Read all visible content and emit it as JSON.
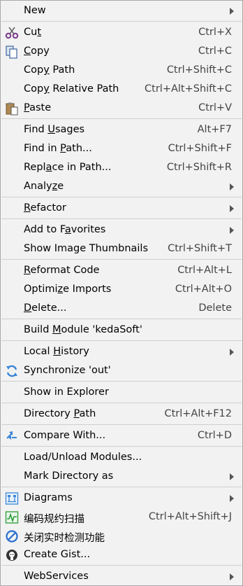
{
  "menu": {
    "new": {
      "pre": "New",
      "mn": "",
      "post": ""
    },
    "cut": {
      "pre": "Cu",
      "mn": "t",
      "post": "",
      "shortcut": "Ctrl+X",
      "icon": "scissors-icon"
    },
    "copy": {
      "pre": "",
      "mn": "C",
      "post": "opy",
      "shortcut": "Ctrl+C",
      "icon": "copy-icon"
    },
    "copy_path": {
      "pre": "Cop",
      "mn": "y",
      "post": " Path",
      "shortcut": "Ctrl+Shift+C"
    },
    "copy_relative_path": {
      "pre": "Cop",
      "mn": "y",
      "post": " Relative Path",
      "shortcut": "Ctrl+Alt+Shift+C"
    },
    "paste": {
      "pre": "",
      "mn": "P",
      "post": "aste",
      "shortcut": "Ctrl+V",
      "icon": "paste-icon"
    },
    "find_usages": {
      "pre": "Find ",
      "mn": "U",
      "post": "sages",
      "shortcut": "Alt+F7"
    },
    "find_in_path": {
      "pre": "Find in ",
      "mn": "P",
      "post": "ath...",
      "shortcut": "Ctrl+Shift+F"
    },
    "replace_in_path": {
      "pre": "Repl",
      "mn": "a",
      "post": "ce in Path...",
      "shortcut": "Ctrl+Shift+R"
    },
    "analyze": {
      "pre": "Analy",
      "mn": "z",
      "post": "e"
    },
    "refactor": {
      "pre": "",
      "mn": "R",
      "post": "efactor"
    },
    "add_to_favorites": {
      "pre": "Add to F",
      "mn": "a",
      "post": "vorites"
    },
    "show_image_thumbnails": {
      "pre": "Show Image Thumbnails",
      "mn": "",
      "post": "",
      "shortcut": "Ctrl+Shift+T"
    },
    "reformat_code": {
      "pre": "",
      "mn": "R",
      "post": "eformat Code",
      "shortcut": "Ctrl+Alt+L"
    },
    "optimize_imports": {
      "pre": "Optimi",
      "mn": "z",
      "post": "e Imports",
      "shortcut": "Ctrl+Alt+O"
    },
    "delete": {
      "pre": "",
      "mn": "D",
      "post": "elete...",
      "shortcut": "Delete"
    },
    "build_module": {
      "pre": "Build ",
      "mn": "M",
      "post": "odule 'kedaSoft'"
    },
    "local_history": {
      "pre": "Local ",
      "mn": "H",
      "post": "istory"
    },
    "synchronize": {
      "pre": "Synchronize 'out'",
      "mn": "",
      "post": "",
      "icon": "sync-icon"
    },
    "show_in_explorer": {
      "pre": "Show in Explorer",
      "mn": "",
      "post": ""
    },
    "directory_path": {
      "pre": "Directory ",
      "mn": "P",
      "post": "ath",
      "shortcut": "Ctrl+Alt+F12"
    },
    "compare_with": {
      "pre": "Compare With...",
      "mn": "",
      "post": "",
      "shortcut": "Ctrl+D",
      "icon": "compare-icon"
    },
    "load_unload_modules": {
      "pre": "Load/Unload Modules...",
      "mn": "",
      "post": ""
    },
    "mark_directory_as": {
      "pre": "Mark Directory as",
      "mn": "",
      "post": ""
    },
    "diagrams": {
      "pre": "Diagrams",
      "mn": "",
      "post": "",
      "icon": "diagram-icon"
    },
    "code_scan": {
      "pre": "编码规约扫描",
      "mn": "",
      "post": "",
      "shortcut": "Ctrl+Alt+Shift+J",
      "icon": "scan-icon"
    },
    "close_realtime_check": {
      "pre": "关闭实时检测功能",
      "mn": "",
      "post": "",
      "icon": "forbidden-icon"
    },
    "create_gist": {
      "pre": "Create Gist...",
      "mn": "",
      "post": "",
      "icon": "github-icon"
    },
    "webservices": {
      "pre": "WebServices",
      "mn": "",
      "post": ""
    }
  },
  "colors": {
    "background": "#f2f2f2",
    "separator": "#cfcfcf",
    "shortcut_text": "#444444"
  }
}
